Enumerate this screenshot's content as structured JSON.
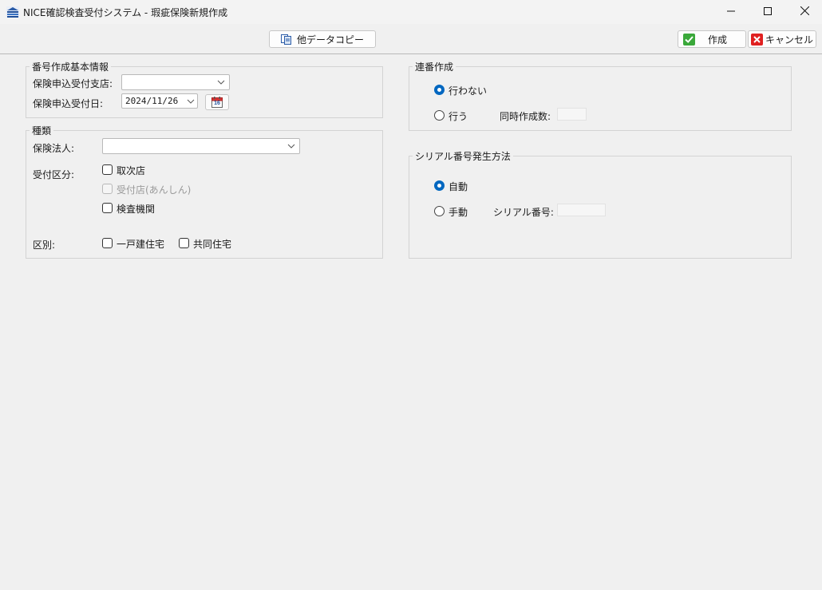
{
  "window": {
    "title": "NICE確認検査受付システム - 瑕疵保険新規作成",
    "icons": {
      "app": "app-logo-icon",
      "minimize": "minimize-icon",
      "maximize": "maximize-icon",
      "close": "close-icon"
    }
  },
  "toolbar": {
    "copy_label": "他データコピー",
    "create_label": "作成",
    "cancel_label": "キャンセル",
    "icons": {
      "copy": "copy-document-icon",
      "create": "checkmark-icon",
      "cancel": "cancel-x-icon"
    },
    "colors": {
      "create_icon": "#3aa83a",
      "cancel_icon": "#e02020"
    }
  },
  "basic_info": {
    "legend": "番号作成基本情報",
    "branch_label": "保険申込受付支店:",
    "branch_value": "",
    "date_label": "保険申込受付日:",
    "date_value": "2024/11/26",
    "calendar_icon": "calendar-icon",
    "calendar_day": "16"
  },
  "kind": {
    "legend": "種類",
    "insurer_label": "保険法人:",
    "insurer_value": "",
    "reception_label": "受付区分:",
    "reception_options": [
      {
        "label": "取次店",
        "checked": false,
        "enabled": true
      },
      {
        "label": "受付店(あんしん)",
        "checked": false,
        "enabled": false
      },
      {
        "label": "検査機関",
        "checked": false,
        "enabled": true
      }
    ],
    "category_label": "区別:",
    "category_options": [
      {
        "label": "一戸建住宅",
        "checked": false
      },
      {
        "label": "共同住宅",
        "checked": false
      }
    ]
  },
  "serial_creation": {
    "legend": "連番作成",
    "option_no": "行わない",
    "option_yes": "行う",
    "selected": "行わない",
    "simultaneous_label": "同時作成数:",
    "simultaneous_value": ""
  },
  "serial_method": {
    "legend": "シリアル番号発生方法",
    "option_auto": "自動",
    "option_manual": "手動",
    "selected": "自動",
    "serial_label": "シリアル番号:",
    "serial_value": ""
  },
  "colors": {
    "accent": "#0067c0",
    "background": "#f0f0f0"
  }
}
